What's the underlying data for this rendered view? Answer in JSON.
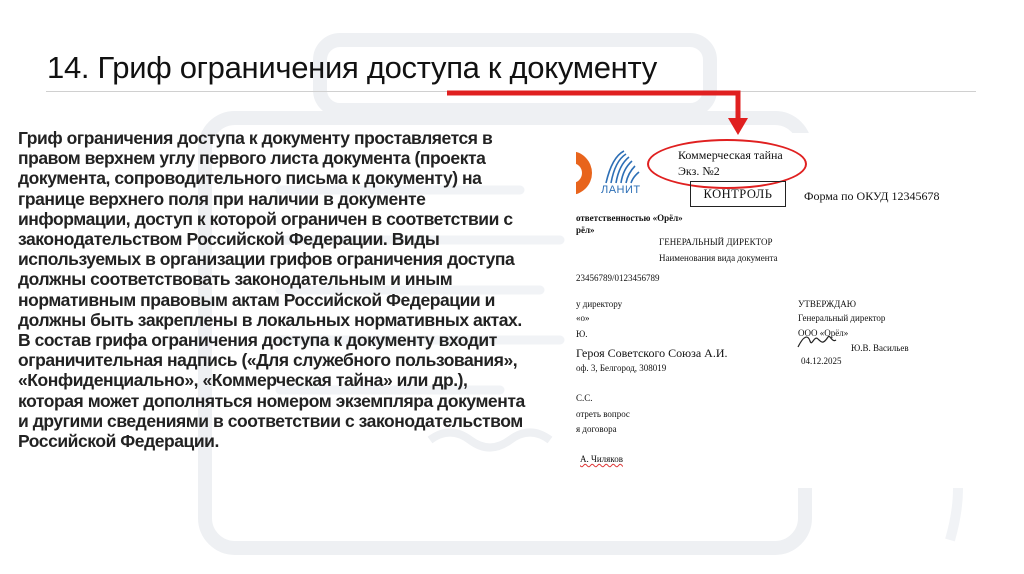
{
  "slide": {
    "title": "14. Гриф ограничения доступа к документу",
    "body": "Гриф ограничения доступа к документу проставляется в правом верхнем углу первого листа документа (проекта документа, сопроводительного письма к документу) на границе верхнего поля при наличии в документе информации, доступ к которой ограничен в соответствии с законодательством Российской Федерации. Виды используемых в организации грифов ограничения доступа должны соответствовать законодательным и иным нормативным правовым актам Российской Федерации и должны быть закреплены в локальных нормативных актах. В состав грифа ограничения доступа к документу входит ограничительная надпись («Для служебного пользования», «Конфиденциально», «Коммерческая тайна» или др.), которая может дополняться номером экземпляра документа и другими сведениями в соответствии с законодательством Российской Федерации."
  },
  "colors": {
    "accent": "#e02020",
    "logo_orange": "#e8641c",
    "logo_blue": "#2d6fb6"
  },
  "icons": {
    "arrow": "red-arrow-icon",
    "signature": "signature-icon"
  },
  "document": {
    "logo_text": "ЛАНИТ",
    "stamp": {
      "line1": "Коммерческая тайна",
      "line2": "Экз. №2"
    },
    "control_label": "КОНТРОЛЬ",
    "okud": "Форма по ОКУД 12345678",
    "org_line1": "ответственностью «Орёл»",
    "org_line2": "рёл»",
    "addressee": "ГЕНЕРАЛЬНЫЙ ДИРЕКТОР",
    "doc_type": "Наименования вида документа",
    "reg_number": "23456789/0123456789",
    "left_block": [
      "у директору",
      "«о»",
      "Ю.",
      "Героя Советского Союза А.И.",
      "оф. 3, Белгород, 308019",
      "С.С.",
      "отреть вопрос",
      "я договора",
      "А. Чиляков"
    ],
    "approve": {
      "title": "УТВЕРЖДАЮ",
      "position": "Генеральный директор",
      "org": "ООО «Орёл»",
      "name": "Ю.В. Васильев",
      "date": "04.12.2025"
    }
  }
}
